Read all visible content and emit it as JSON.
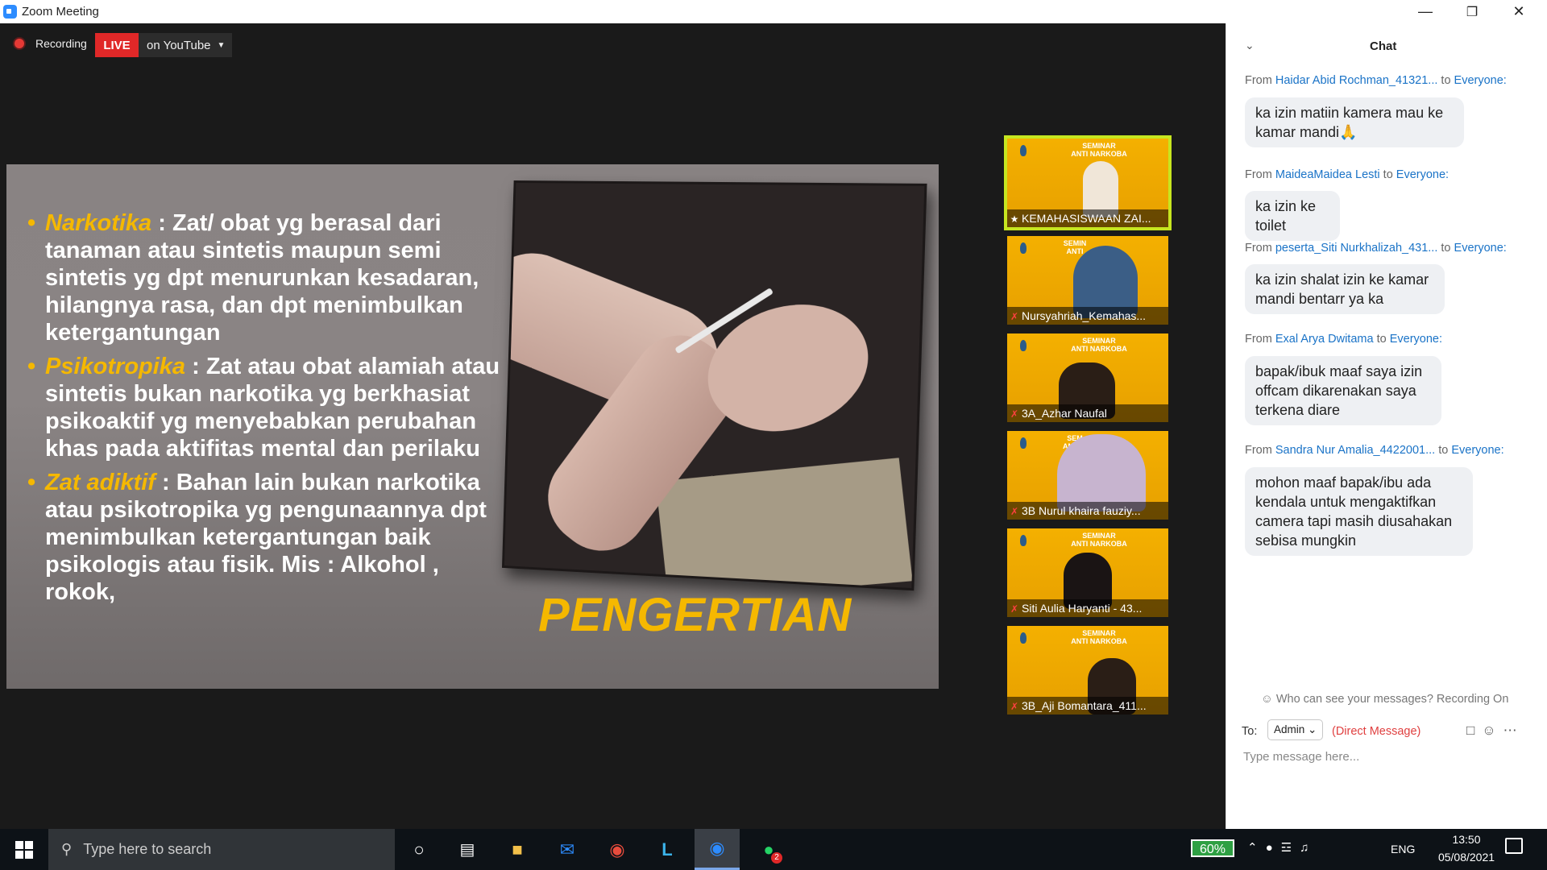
{
  "window": {
    "title": "Zoom Meeting",
    "min_icon": "minimize-icon",
    "max_icon": "maximize-icon",
    "close_icon": "close-icon"
  },
  "recording": {
    "label": "Recording",
    "live_badge": "LIVE",
    "live_target": "on YouTube"
  },
  "slide": {
    "bullets": [
      {
        "term": "Narkotika",
        "text": " : Zat/ obat yg berasal dari tanaman atau sintetis maupun semi sintetis yg dpt menurunkan kesadaran, hilangnya rasa, dan dpt menimbulkan ketergantungan"
      },
      {
        "term": "Psikotropika",
        "text": " : Zat atau obat alamiah atau sintetis bukan narkotika yg berkhasiat psikoaktif yg menyebabkan perubahan khas pada aktifitas mental dan perilaku"
      },
      {
        "term": "Zat adiktif",
        "text": " : Bahan lain bukan narkotika atau psikotropika yg pengunaannya dpt menimbulkan ketergantungan baik psikologis atau fisik. Mis : Alkohol , rokok,"
      }
    ],
    "heading": "PENGERTIAN"
  },
  "participants": [
    {
      "name": "KEMAHASISWAAN ZAI...",
      "seminar_line1": "SEMINAR",
      "seminar_line2": "ANTI NARKOBA",
      "mic_icon": "host-pin-icon"
    },
    {
      "name": "Nursyahriah_Kemahas...",
      "seminar_line1": "SEMIN",
      "seminar_line2": "ANTI",
      "mic_icon": "mic-muted-icon"
    },
    {
      "name": "3A_Azhar Naufal",
      "seminar_line1": "SEMINAR",
      "seminar_line2": "ANTI NARKOBA",
      "mic_icon": "mic-muted-icon"
    },
    {
      "name": "3B Nurul khaira fauziy...",
      "seminar_line1": "SEM",
      "seminar_line2": "ANTI N",
      "mic_icon": "mic-muted-icon"
    },
    {
      "name": "Siti Aulia Haryanti - 43...",
      "seminar_line1": "SEMINAR",
      "seminar_line2": "ANTI NARKOBA",
      "mic_icon": "mic-muted-icon"
    },
    {
      "name": "3B_Aji Bomantara_411...",
      "seminar_line1": "SEMINAR",
      "seminar_line2": "ANTI NARKOBA",
      "mic_icon": "mic-muted-icon"
    }
  ],
  "chat": {
    "title": "Chat",
    "messages": [
      {
        "from_prefix": "From ",
        "sender": "Haidar Abid Rochman_41321...",
        "to_prefix": " to ",
        "recipient": "Everyone:",
        "text": "ka izin matiin kamera mau ke kamar mandi🙏"
      },
      {
        "from_prefix": "From ",
        "sender": "MaideaMaidea Lesti",
        "to_prefix": " to ",
        "recipient": "Everyone:",
        "text": "ka izin ke toilet"
      },
      {
        "from_prefix": "From ",
        "sender": "peserta_Siti Nurkhalizah_431...",
        "to_prefix": " to ",
        "recipient": "Everyone:",
        "text": "ka izin shalat izin ke kamar mandi bentarr ya ka"
      },
      {
        "from_prefix": "From ",
        "sender": "Exal Arya Dwitama",
        "to_prefix": " to ",
        "recipient": "Everyone:",
        "text": "bapak/ibuk maaf saya izin offcam dikarenakan saya terkena diare"
      },
      {
        "from_prefix": "From ",
        "sender": "Sandra Nur Amalia_4422001...",
        "to_prefix": " to ",
        "recipient": "Everyone:",
        "text": "mohon maaf bapak/ibu ada kendala untuk mengaktifkan camera tapi masih diusahakan sebisa mungkin"
      }
    ],
    "privacy_note": "Who can see your messages? Recording On",
    "to_label": "To:",
    "to_value": "Admin",
    "dm_label": "(Direct Message)",
    "input_placeholder": "Type message here..."
  },
  "taskbar": {
    "search_placeholder": "Type here to search",
    "battery": "60%",
    "language": "ENG",
    "time": "13:50",
    "date": "05/08/2021",
    "notification_count": "2"
  }
}
